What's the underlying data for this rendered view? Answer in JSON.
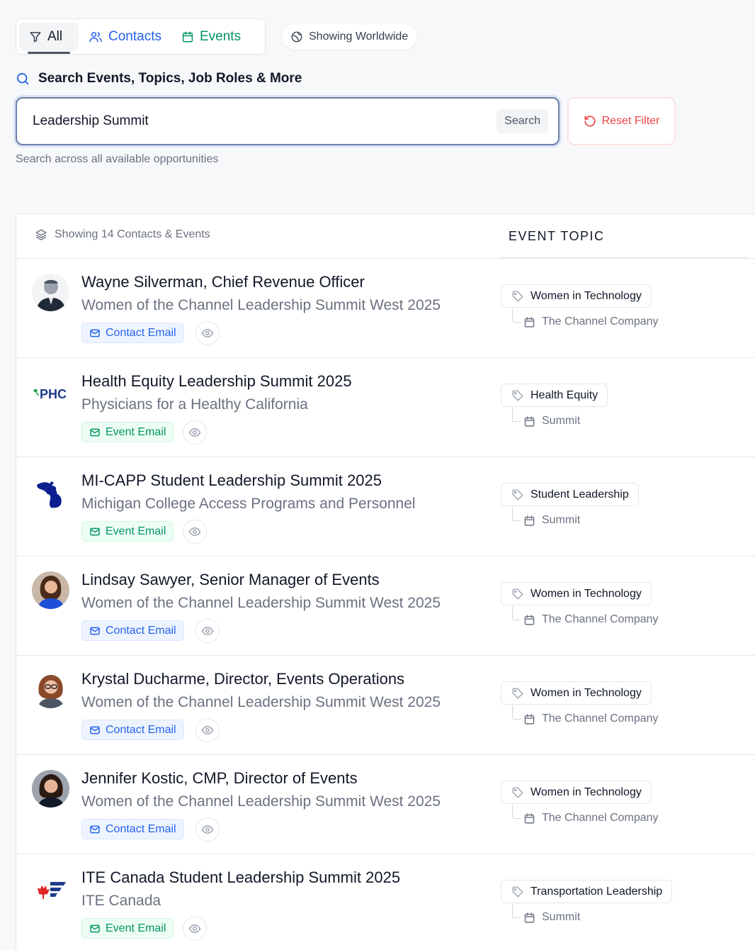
{
  "filters": {
    "all_label": "All",
    "contacts_label": "Contacts",
    "events_label": "Events",
    "worldwide_label": "Showing Worldwide"
  },
  "search": {
    "heading": "Search Events, Topics, Job Roles & More",
    "value": "Leadership Summit",
    "button_label": "Search",
    "reset_label": "Reset Filter",
    "hint": "Search across all available opportunities"
  },
  "results": {
    "count_label": "Showing 14 Contacts & Events",
    "topic_header": "EVENT TOPIC",
    "items": [
      {
        "type": "contact",
        "title": "Wayne Silverman, Chief Revenue Officer",
        "subtitle": "Women of the Channel Leadership Summit West 2025",
        "email_label": "Contact Email",
        "topic": "Women in Technology",
        "org": "The Channel Company"
      },
      {
        "type": "event",
        "logo_text": "PHC",
        "title": "Health Equity Leadership Summit 2025",
        "subtitle": "Physicians for a Healthy California",
        "email_label": "Event Email",
        "topic": "Health Equity",
        "org": "Summit"
      },
      {
        "type": "event",
        "title": "MI-CAPP Student Leadership Summit 2025",
        "subtitle": "Michigan College Access Programs and Personnel",
        "email_label": "Event Email",
        "topic": "Student Leadership",
        "org": "Summit"
      },
      {
        "type": "contact",
        "title": "Lindsay Sawyer, Senior Manager of Events",
        "subtitle": "Women of the Channel Leadership Summit West 2025",
        "email_label": "Contact Email",
        "topic": "Women in Technology",
        "org": "The Channel Company"
      },
      {
        "type": "contact",
        "title": "Krystal Ducharme, Director, Events Operations",
        "subtitle": "Women of the Channel Leadership Summit West 2025",
        "email_label": "Contact Email",
        "topic": "Women in Technology",
        "org": "The Channel Company"
      },
      {
        "type": "contact",
        "title": "Jennifer Kostic, CMP, Director of Events",
        "subtitle": "Women of the Channel Leadership Summit West 2025",
        "email_label": "Contact Email",
        "topic": "Women in Technology",
        "org": "The Channel Company"
      },
      {
        "type": "event",
        "title": "ITE Canada Student Leadership Summit 2025",
        "subtitle": "ITE Canada",
        "email_label": "Event Email",
        "topic": "Transportation Leadership",
        "org": "Summit"
      }
    ]
  },
  "colors": {
    "contact_blue": "#2563eb",
    "event_green": "#059669",
    "reset_red": "#ef4444"
  },
  "icons": {
    "filter": "filter-icon",
    "contacts": "users-icon",
    "events": "calendar-icon",
    "worldwide": "globe-icon",
    "search": "search-icon",
    "reset": "rotate-ccw-icon",
    "layers": "layers-icon",
    "mail": "mail-icon",
    "eye": "eye-icon",
    "tag": "tag-icon"
  }
}
